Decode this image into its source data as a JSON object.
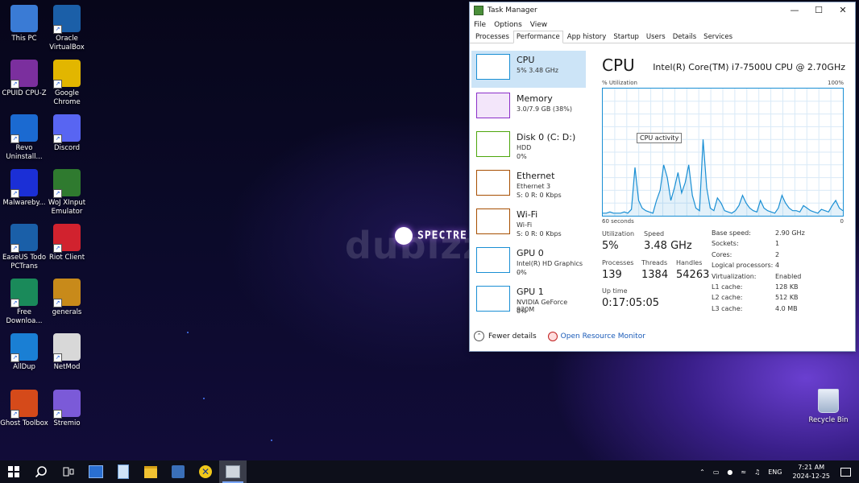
{
  "desktop": {
    "icons": [
      {
        "label": "This PC",
        "icon": "computer-icon",
        "color": "#3a7bd5"
      },
      {
        "label": "Oracle VirtualBox",
        "icon": "virtualbox-icon",
        "color": "#1b5fa8"
      },
      {
        "label": "CPUID CPU-Z",
        "icon": "cpu-z-icon",
        "color": "#7b2f9e"
      },
      {
        "label": "Google Chrome",
        "icon": "chrome-icon",
        "color": "#e2b600"
      },
      {
        "label": "Revo Uninstall...",
        "icon": "revo-uninstaller-icon",
        "color": "#1b6ad1"
      },
      {
        "label": "Discord",
        "icon": "discord-icon",
        "color": "#5865f2"
      },
      {
        "label": "Malwareby...",
        "icon": "malwarebytes-icon",
        "color": "#1b2fd6"
      },
      {
        "label": "WoJ XInput Emulator",
        "icon": "xbox-icon",
        "color": "#2f7a2f"
      },
      {
        "label": "EaseUS Todo PCTrans",
        "icon": "pctrans-icon",
        "color": "#1a5fa8"
      },
      {
        "label": "Riot Client",
        "icon": "riot-icon",
        "color": "#d1222e"
      },
      {
        "label": "Free Downloa...",
        "icon": "download-icon",
        "color": "#1a8a5a"
      },
      {
        "label": "generals",
        "icon": "generals-icon",
        "color": "#c88a1a"
      },
      {
        "label": "AllDup",
        "icon": "alldup-icon",
        "color": "#1a7fd4"
      },
      {
        "label": "NetMod",
        "icon": "netmod-icon",
        "color": "#d8d8d8"
      },
      {
        "label": "Ghost Toolbox",
        "icon": "ghost-toolbox-icon",
        "color": "#d54a1a"
      },
      {
        "label": "Stremio",
        "icon": "stremio-icon",
        "color": "#7b5ad8"
      }
    ],
    "recycle_bin": "Recycle Bin",
    "wallpaper_logo": "SPECTRE",
    "watermark": "dubizzle"
  },
  "task_manager": {
    "title": "Task Manager",
    "menu": [
      "File",
      "Options",
      "View"
    ],
    "tabs": [
      "Processes",
      "Performance",
      "App history",
      "Startup",
      "Users",
      "Details",
      "Services"
    ],
    "active_tab": "Performance",
    "sidebar": [
      {
        "name": "CPU",
        "line2": "5%  3.48 GHz",
        "line3": "",
        "color": "#1a8fd4"
      },
      {
        "name": "Memory",
        "line2": "3.0/7.9 GB (38%)",
        "line3": "",
        "color": "#8b2fc9"
      },
      {
        "name": "Disk 0 (C: D:)",
        "line2": "HDD",
        "line3": "0%",
        "color": "#4da60c"
      },
      {
        "name": "Ethernet",
        "line2": "Ethernet 3",
        "line3": "S: 0  R: 0 Kbps",
        "color": "#a74f01"
      },
      {
        "name": "Wi-Fi",
        "line2": "Wi-Fi",
        "line3": "S: 0  R: 0 Kbps",
        "color": "#a74f01"
      },
      {
        "name": "GPU 0",
        "line2": "Intel(R) HD Graphics ...",
        "line3": "0%",
        "color": "#1a8fd4"
      },
      {
        "name": "GPU 1",
        "line2": "NVIDIA GeForce 920M",
        "line3": "0%",
        "color": "#1a8fd4"
      }
    ],
    "cpu": {
      "title": "CPU",
      "model": "Intel(R) Core(TM) i7-7500U CPU @ 2.70GHz",
      "util_label": "% Utilization",
      "max_label": "100%",
      "time_label": "60 seconds",
      "min_label": "0",
      "tooltip": "CPU activity",
      "stats": {
        "utilization_label": "Utilization",
        "utilization": "5%",
        "speed_label": "Speed",
        "speed": "3.48 GHz",
        "processes_label": "Processes",
        "processes": "139",
        "threads_label": "Threads",
        "threads": "1384",
        "handles_label": "Handles",
        "handles": "54263",
        "uptime_label": "Up time",
        "uptime": "0:17:05:05"
      },
      "specs": [
        {
          "k": "Base speed:",
          "v": "2.90 GHz"
        },
        {
          "k": "Sockets:",
          "v": "1"
        },
        {
          "k": "Cores:",
          "v": "2"
        },
        {
          "k": "Logical processors:",
          "v": "4"
        },
        {
          "k": "Virtualization:",
          "v": "Enabled"
        },
        {
          "k": "L1 cache:",
          "v": "128 KB"
        },
        {
          "k": "L2 cache:",
          "v": "512 KB"
        },
        {
          "k": "L3 cache:",
          "v": "4.0 MB"
        }
      ],
      "history": [
        2,
        2,
        3,
        2,
        2,
        2,
        3,
        2,
        5,
        38,
        12,
        6,
        4,
        3,
        2,
        12,
        20,
        40,
        30,
        12,
        22,
        34,
        18,
        26,
        40,
        16,
        6,
        4,
        60,
        22,
        6,
        4,
        14,
        10,
        4,
        3,
        2,
        4,
        8,
        16,
        10,
        6,
        4,
        3,
        12,
        6,
        4,
        3,
        2,
        6,
        16,
        10,
        6,
        4,
        4,
        3,
        8,
        6,
        4,
        3,
        2,
        5,
        4,
        3,
        8,
        12,
        6,
        4
      ]
    },
    "footer": {
      "fewer_details": "Fewer details",
      "resource_monitor": "Open Resource Monitor"
    }
  },
  "taskbar": {
    "apps": [
      "start-icon",
      "search-icon",
      "task-view-icon",
      "app-icon-1",
      "notepad-icon",
      "file-explorer-icon",
      "app-icon-2",
      "xbox-app-icon",
      "task-manager-icon"
    ],
    "language": "ENG",
    "time": "7:21 AM",
    "date": "2024-12-25"
  }
}
